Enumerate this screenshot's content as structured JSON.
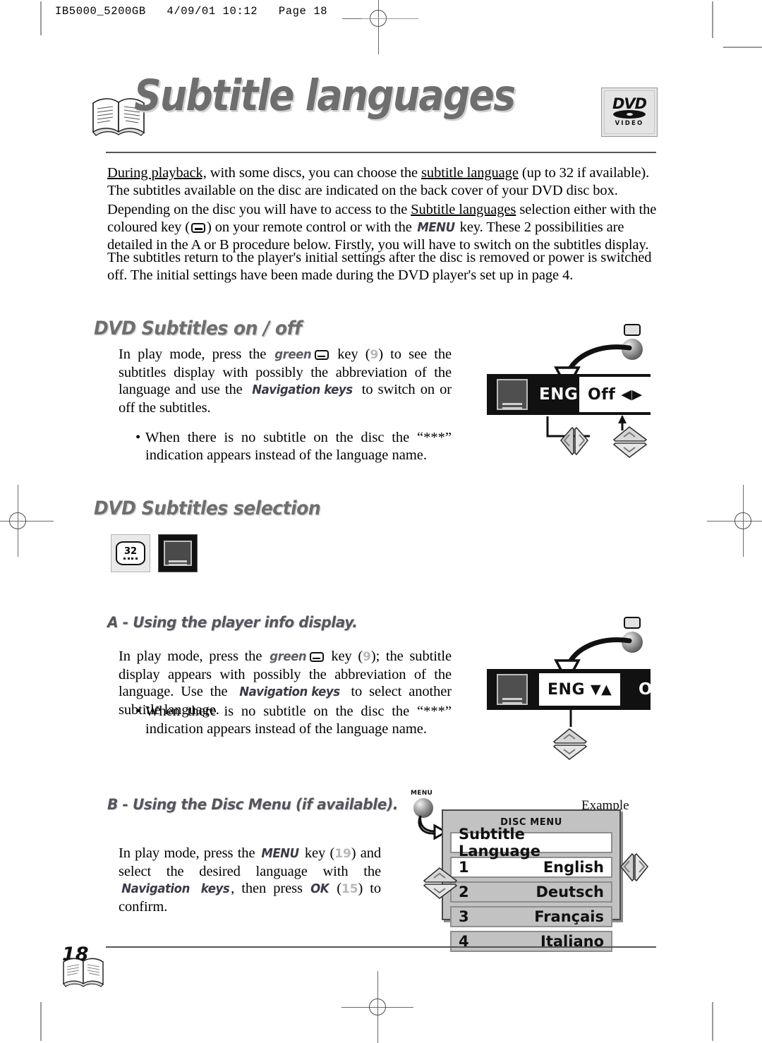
{
  "print_slug": "IB5000_5200GB   4/09/01 10:12   Page 18",
  "title": {
    "text": "Subtitle languages",
    "logo": {
      "word": "DVD",
      "sub": "VIDEO"
    },
    "book_icon": "book-icon"
  },
  "intro": {
    "p1_a": "During playback,",
    "p1_b": " with some discs, you can choose the ",
    "p1_c": "subtitle language",
    "p1_d": " (up to 32  if available). The subtitles available on the disc are indicated on the back cover of your DVD disc box.",
    "p2_a": "Depending on the disc you will have to access to the ",
    "p2_b": "Subtitle languages",
    "p2_c": " selection either with the coloured key (",
    "p2_d": ") on your remote control or with the ",
    "p2_menu": "MENU",
    "p2_e": " key. These 2 possibilities are detailed in the A or B procedure below. Firstly, you will have to switch on the subtitles display.",
    "p3": "The subtitles return to the player's initial settings after the disc is removed or power is switched off. The initial settings have been made during the DVD player's set up in page 4."
  },
  "section_onoff": {
    "heading": "DVD Subtitles on / off",
    "body_a": "In play mode, press the ",
    "body_green": "green",
    "body_b": " key (",
    "body_ref": "9",
    "body_c": ") to see the subtitles display   with possibly the abbreviation of the language and use the ",
    "body_nav": "Navigation keys",
    "body_d": " to switch on or off the subtitles.",
    "bullet": "When there is no subtitle on the disc the “***” indication appears instead of the language name.",
    "osd": {
      "language": "ENG",
      "value": "Off",
      "arrows": "◀▶",
      "subtitle_icon": "subtitle-screen-icon"
    }
  },
  "section_selection": {
    "heading": "DVD Subtitles selection",
    "icon_count": "32"
  },
  "section_a": {
    "heading": "A - Using the player info display.",
    "body_a": "In play mode, press the ",
    "body_green": "green",
    "body_b": " key (",
    "body_ref": "9",
    "body_c": "); the subtitle display appears with possibly the abbreviation of the language. Use the ",
    "body_nav": "Navigation keys",
    "body_d": " to select another subtitle language.",
    "bullet": "When there is no subtitle on the disc the “***” indication appears instead of the language name.",
    "osd": {
      "language": "ENG",
      "arrows": "▼▲",
      "value": "On"
    }
  },
  "section_b": {
    "heading": "B - Using the Disc Menu (if available).",
    "body_a": "In play mode, press the ",
    "body_menu": "MENU",
    "body_b": " key (",
    "body_ref1": "19",
    "body_c": ") and select the desired language with the ",
    "body_nav": "Navigation",
    "body_nav2": "keys",
    "body_d": ", then press ",
    "body_ok": "OK",
    "body_e": " (",
    "body_ref2": "15",
    "body_f": ")  to confirm.",
    "menu_button_label": "MENU",
    "example_label": "Example",
    "disc_menu": {
      "header": "DISC MENU",
      "subheader": "Subtitle Language",
      "rows": [
        {
          "num": "1",
          "label": "English",
          "selected": true
        },
        {
          "num": "2",
          "label": "Deutsch",
          "selected": false
        },
        {
          "num": "3",
          "label": "Français",
          "selected": false
        },
        {
          "num": "4",
          "label": "Italiano",
          "selected": false
        }
      ]
    }
  },
  "footer": {
    "page_number": "18"
  }
}
